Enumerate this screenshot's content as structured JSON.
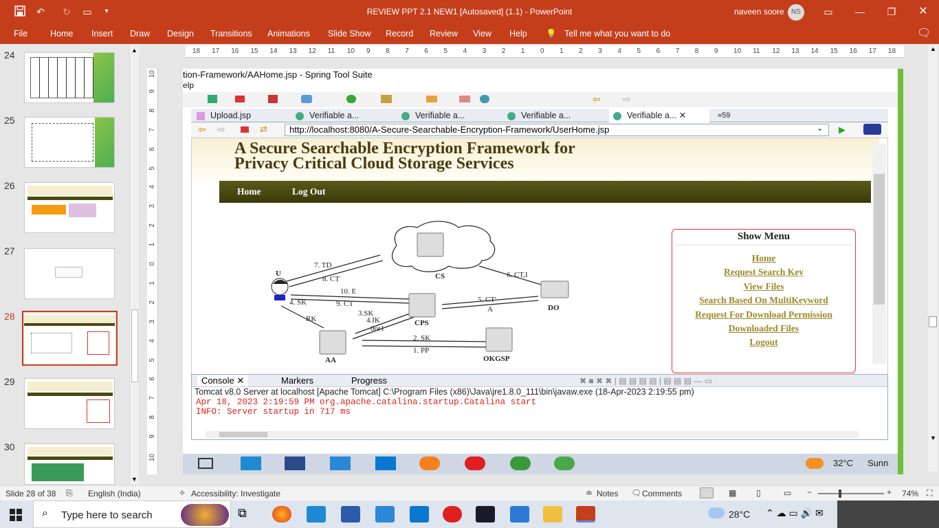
{
  "window": {
    "title": "REVIEW PPT 2.1 NEW1 [Autosaved] (1.1)  -  PowerPoint",
    "user_name": "naveen soore",
    "user_initials": "NS"
  },
  "ribbon": {
    "tabs": [
      "File",
      "Home",
      "Insert",
      "Draw",
      "Design",
      "Transitions",
      "Animations",
      "Slide Show",
      "Record",
      "Review",
      "View",
      "Help"
    ],
    "tell_me": "Tell me what you want to do"
  },
  "ruler": {
    "h_labels": [
      "18",
      "17",
      "16",
      "15",
      "14",
      "13",
      "12",
      "11",
      "10",
      "9",
      "8",
      "7",
      "6",
      "5",
      "4",
      "3",
      "2",
      "1",
      "0",
      "1",
      "2",
      "3",
      "4",
      "5",
      "6",
      "7",
      "8",
      "9",
      "10",
      "11",
      "12",
      "13",
      "14",
      "15",
      "16",
      "17",
      "18"
    ],
    "v_labels": [
      "10",
      "9",
      "8",
      "7",
      "6",
      "5",
      "4",
      "3",
      "2",
      "1",
      "0",
      "1",
      "2",
      "3",
      "4",
      "5",
      "6",
      "7",
      "8",
      "9",
      "10"
    ]
  },
  "thumbnails": [
    {
      "num": "24"
    },
    {
      "num": "25"
    },
    {
      "num": "26"
    },
    {
      "num": "27"
    },
    {
      "num": "28",
      "selected": true
    },
    {
      "num": "29"
    },
    {
      "num": "30"
    }
  ],
  "slide": {
    "eclipse_title": "tion-Framework/AAHome.jsp - Spring Tool Suite",
    "eclipse_menu": "elp",
    "tabs": [
      "Upload.jsp",
      "Verifiable a...",
      "Verifiable a...",
      "Verifiable a...",
      "Verifiable a..."
    ],
    "tab_overflow": "59",
    "url": "http://localhost:8080/A-Secure-Searchable-Encryption-Framework/UserHome.jsp",
    "site_title_1": "A Secure Searchable Encryption Framework for",
    "site_title_2": "Privacy Critical Cloud Storage Services",
    "nav": [
      "Home",
      "Log Out"
    ],
    "menu_title": "Show Menu",
    "menu_links": [
      "Home",
      "Request Search Key",
      "View Files",
      "Search Based On MultiKeyword",
      "Request For Download Permission",
      "Downloaded Files",
      "Logout"
    ],
    "diagram": {
      "nodes": [
        "U",
        "CS",
        "CPS",
        "DO",
        "AA",
        "OKGSP"
      ],
      "edges": [
        "7. TD",
        "8. CT",
        "10.  E",
        "9. CT",
        "5. CT'",
        "A",
        "6. CT,I",
        "3.SK",
        "4.IK",
        "0or1",
        "4. SK",
        "RK",
        "2. SK",
        "1. PP"
      ]
    },
    "console_tabs": [
      "Console",
      "Markers",
      "Progress"
    ],
    "console_header": "Tomcat v8.0 Server at localhost [Apache Tomcat] C:\\Program Files (x86)\\Java\\jre1.8.0_111\\bin\\javaw.exe (18-Apr-2023 2:19:55 pm)",
    "console_lines": [
      "Apr 18, 2023 2:19:59 PM org.apache.catalina.startup.Catalina start",
      "INFO: Server startup in 717 ms"
    ],
    "weather": "32°C",
    "weather_text": "Sunn"
  },
  "status": {
    "slide_info": "Slide 28 of 38",
    "language": "English (India)",
    "accessibility": "Accessibility: Investigate",
    "notes": "Notes",
    "comments": "Comments",
    "zoom": "74%"
  },
  "taskbar": {
    "search_placeholder": "Type here to search",
    "temperature": "28°C"
  },
  "colors": {
    "accent": "#c43e1c",
    "console_red": "#e0201a",
    "site_olive": "#4a4a0e"
  }
}
